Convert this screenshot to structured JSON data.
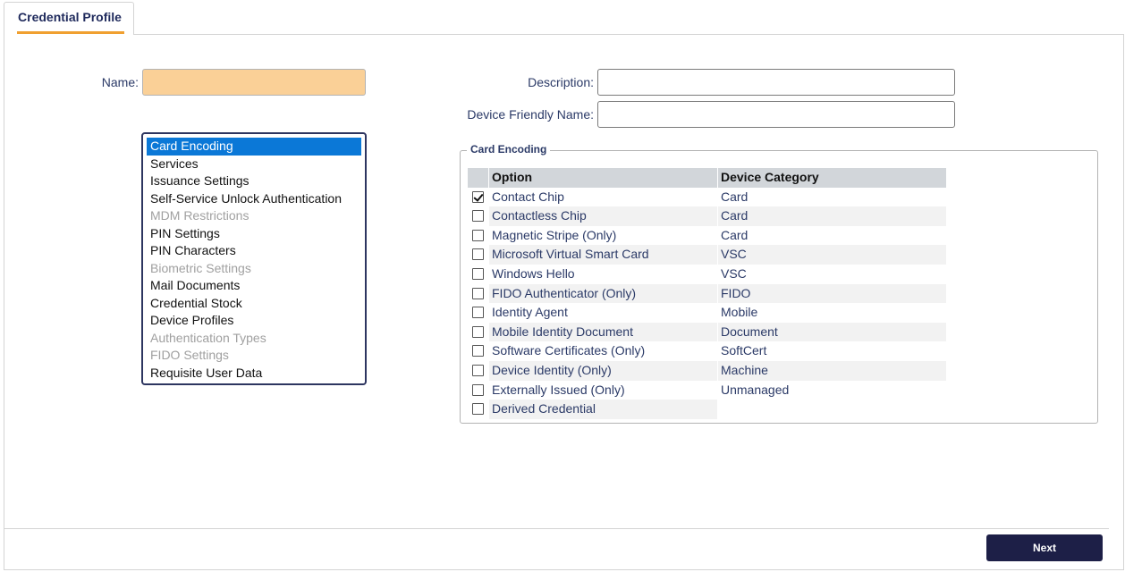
{
  "tab": {
    "title": "Credential Profile"
  },
  "form": {
    "name_label": "Name:",
    "name_value": "",
    "description_label": "Description:",
    "description_value": "",
    "device_friendly_name_label": "Device Friendly Name:",
    "device_friendly_name_value": ""
  },
  "sections": [
    {
      "label": "Card Encoding",
      "state": "selected"
    },
    {
      "label": "Services",
      "state": "enabled"
    },
    {
      "label": "Issuance Settings",
      "state": "enabled"
    },
    {
      "label": "Self-Service Unlock Authentication",
      "state": "enabled"
    },
    {
      "label": "MDM Restrictions",
      "state": "disabled"
    },
    {
      "label": "PIN Settings",
      "state": "enabled"
    },
    {
      "label": "PIN Characters",
      "state": "enabled"
    },
    {
      "label": "Biometric Settings",
      "state": "disabled"
    },
    {
      "label": "Mail Documents",
      "state": "enabled"
    },
    {
      "label": "Credential Stock",
      "state": "enabled"
    },
    {
      "label": "Device Profiles",
      "state": "enabled"
    },
    {
      "label": "Authentication Types",
      "state": "disabled"
    },
    {
      "label": "FIDO Settings",
      "state": "disabled"
    },
    {
      "label": "Requisite User Data",
      "state": "enabled"
    }
  ],
  "card_encoding": {
    "legend": "Card Encoding",
    "columns": {
      "option": "Option",
      "category": "Device Category"
    },
    "rows": [
      {
        "option": "Contact Chip",
        "category": "Card",
        "checked": true
      },
      {
        "option": "Contactless Chip",
        "category": "Card",
        "checked": false
      },
      {
        "option": "Magnetic Stripe (Only)",
        "category": "Card",
        "checked": false
      },
      {
        "option": "Microsoft Virtual Smart Card",
        "category": "VSC",
        "checked": false
      },
      {
        "option": "Windows Hello",
        "category": "VSC",
        "checked": false
      },
      {
        "option": "FIDO Authenticator (Only)",
        "category": "FIDO",
        "checked": false
      },
      {
        "option": "Identity Agent",
        "category": "Mobile",
        "checked": false
      },
      {
        "option": "Mobile Identity Document",
        "category": "Document",
        "checked": false
      },
      {
        "option": "Software Certificates (Only)",
        "category": "SoftCert",
        "checked": false
      },
      {
        "option": "Device Identity (Only)",
        "category": "Machine",
        "checked": false
      },
      {
        "option": "Externally Issued (Only)",
        "category": "Unmanaged",
        "checked": false
      },
      {
        "option": "Derived Credential",
        "category": "",
        "checked": false
      }
    ]
  },
  "footer": {
    "next_label": "Next"
  },
  "colors": {
    "accent": "#f0a030",
    "selection": "#0b78d7",
    "primary_button": "#1d1f47",
    "name_field": "#fad097"
  }
}
